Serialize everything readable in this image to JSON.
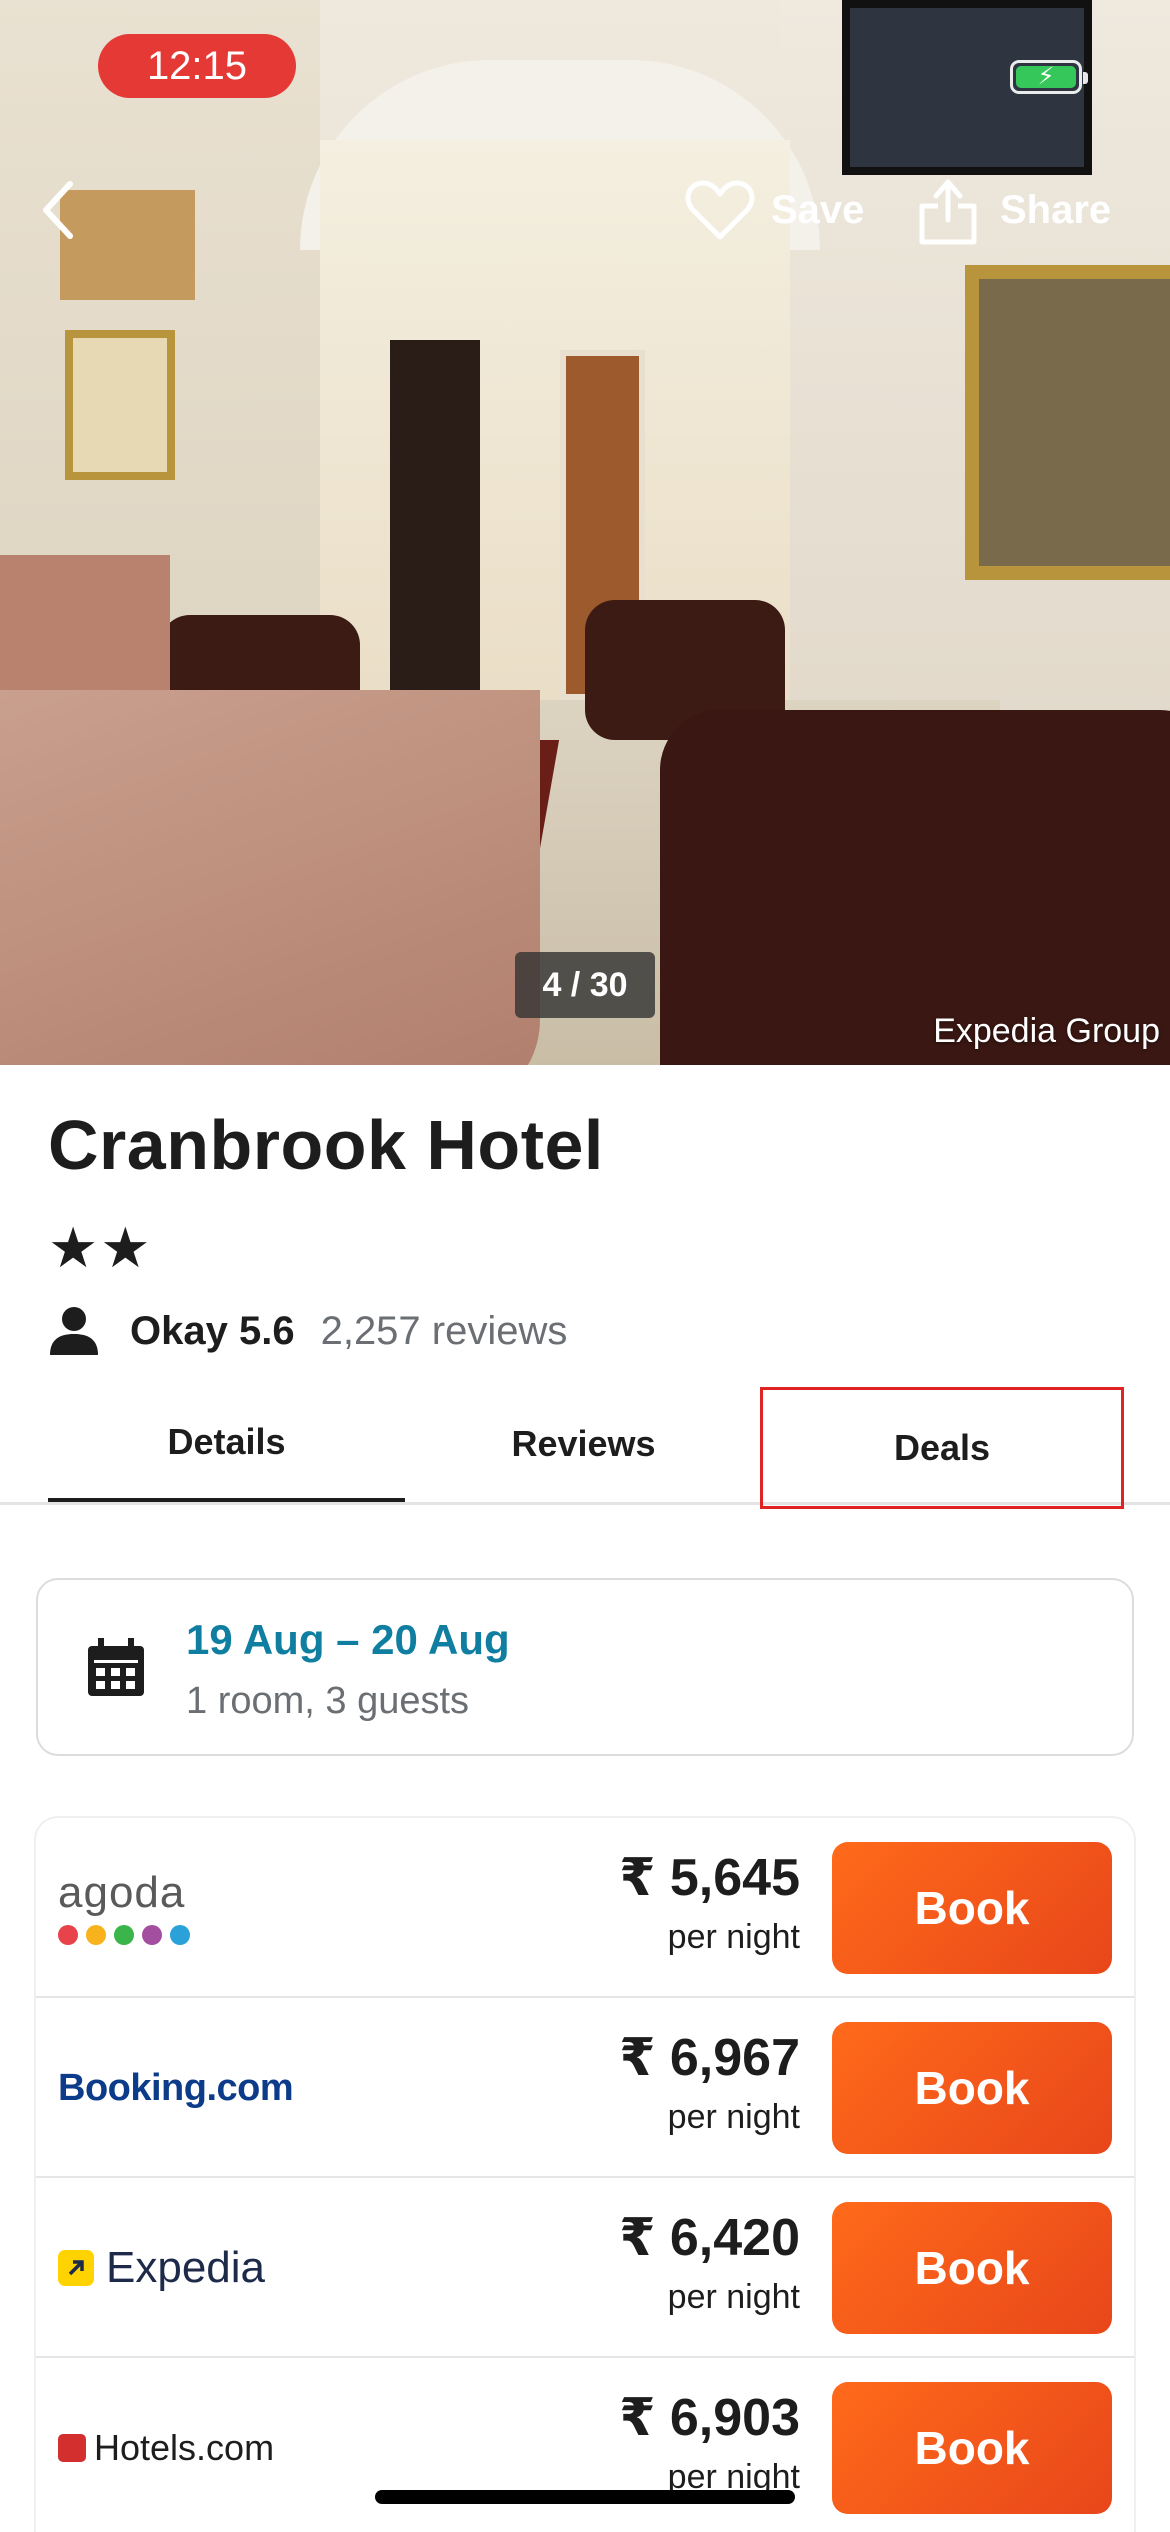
{
  "status_bar": {
    "time": "12:15",
    "battery_symbol": "⚡"
  },
  "gallery": {
    "save_label": "Save",
    "share_label": "Share",
    "counter": "4 / 30",
    "credit": "Expedia Group"
  },
  "hotel": {
    "name": "Cranbrook Hotel",
    "stars": "★★",
    "star_count": 2,
    "rating": "Okay 5.6",
    "reviews": "2,257 reviews"
  },
  "tabs": [
    {
      "label": "Details",
      "active": true
    },
    {
      "label": "Reviews",
      "active": false
    },
    {
      "label": "Deals",
      "active": false,
      "highlighted": true
    }
  ],
  "search": {
    "dates": "19 Aug – 20 Aug",
    "guests": "1 room, 3 guests"
  },
  "deals": [
    {
      "provider": "agoda",
      "price": "₹ 5,645",
      "unit": "per night",
      "button": "Book"
    },
    {
      "provider": "Booking.com",
      "price": "₹ 6,967",
      "unit": "per night",
      "button": "Book"
    },
    {
      "provider": "Expedia",
      "price": "₹ 6,420",
      "unit": "per night",
      "button": "Book"
    },
    {
      "provider": "Hotels.com",
      "price": "₹ 6,903",
      "unit": "per night",
      "button": "Book"
    }
  ],
  "colors": {
    "accent_book": "#ff6a1a",
    "date_link": "#0f7ea0",
    "status_time_bg": "#e53935",
    "deals_tab_outline": "#e02323"
  },
  "icons": [
    "back-chevron-icon",
    "heart-icon",
    "share-icon",
    "battery-icon",
    "person-icon",
    "calendar-icon"
  ]
}
